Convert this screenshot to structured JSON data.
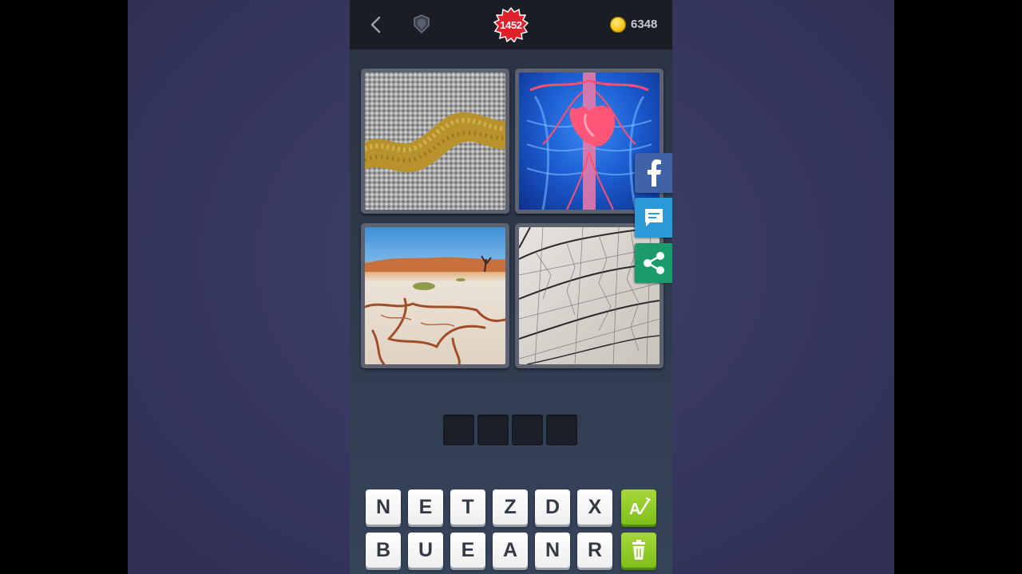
{
  "top_bar": {
    "level": "1452",
    "coins": "6348",
    "back_icon": "chevron-left-icon",
    "hint_icon": "shield-icon",
    "coin_icon": "coin-icon"
  },
  "pictures": [
    {
      "subject": "gold vein in gravel",
      "icon": "photo"
    },
    {
      "subject": "human heart and veins",
      "icon": "photo"
    },
    {
      "subject": "cracked desert ground",
      "icon": "photo"
    },
    {
      "subject": "leaf veins close-up",
      "icon": "photo"
    }
  ],
  "answer": {
    "length": 4,
    "slots": [
      "",
      "",
      "",
      ""
    ]
  },
  "letters": {
    "row1": [
      "N",
      "E",
      "T",
      "Z",
      "D",
      "X"
    ],
    "row2": [
      "B",
      "U",
      "E",
      "A",
      "N",
      "R"
    ]
  },
  "actions": {
    "reveal_icon": "reveal-letter-icon",
    "remove_icon": "trash-icon"
  },
  "share": {
    "facebook_icon": "facebook-icon",
    "message_icon": "message-icon",
    "share_icon": "share-icon"
  },
  "colors": {
    "level_badge": "#e0202a",
    "green_button": "#8fcb24",
    "facebook": "#3f63a6",
    "message": "#2b9ad6",
    "share": "#1b9a6b"
  }
}
